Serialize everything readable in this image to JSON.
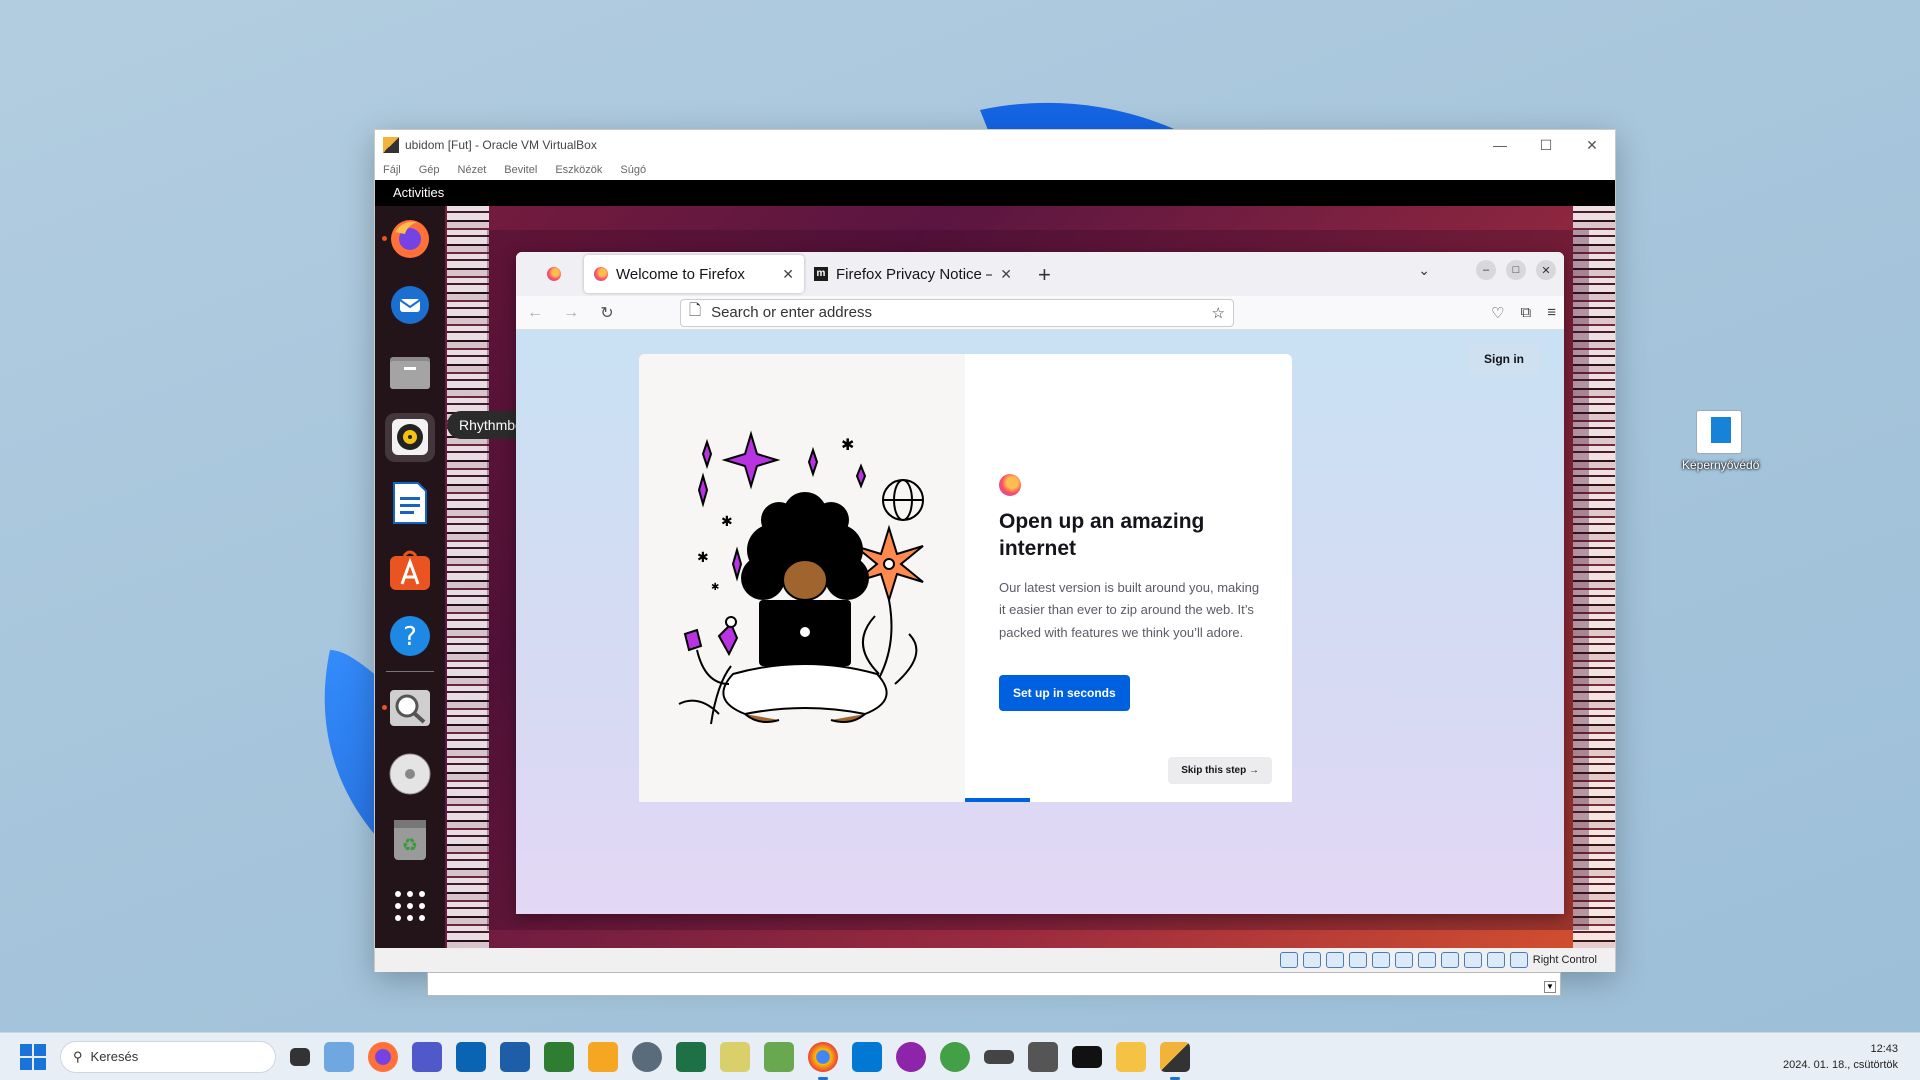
{
  "desktop": {
    "shortcut_label": "Képernyővédő"
  },
  "vbox": {
    "title": "ubidom [Fut] - Oracle VM VirtualBox",
    "menu": [
      "Fájl",
      "Gép",
      "Nézet",
      "Bevitel",
      "Eszközök",
      "Súgó"
    ],
    "host_key_label": "Right Control"
  },
  "ubuntu": {
    "topbar_text": "Activities",
    "tooltip": "Rhythmbox",
    "dock_items": [
      "firefox",
      "thunderbird",
      "files",
      "rhythmbox",
      "libreoffice-writer",
      "app-center",
      "help",
      "image-viewer",
      "disc",
      "trash",
      "show-apps"
    ]
  },
  "firefox": {
    "tabs": [
      {
        "label": "Welcome to Firefox",
        "icon": "firefox-icon"
      },
      {
        "label": "Firefox Privacy Notice —",
        "icon": "mdn-icon"
      }
    ],
    "url_placeholder": "Search or enter address",
    "signin_label": "Sign in",
    "headline": "Open up an amazing internet",
    "subtext": "Our latest version is built around you, making it easier than ever to zip around the web. It’s packed with features we think you’ll adore.",
    "primary_button": "Set up in seconds",
    "skip_button": "Skip this step →",
    "progress_fraction": 0.2
  },
  "taskbar": {
    "search_placeholder": "Keresés",
    "time": "12:43",
    "date": "2024. 01. 18., csütörtök"
  },
  "colors": {
    "accent": "#0061e0",
    "ubuntu_orange": "#e95420",
    "windows_blue": "#1a73d9"
  }
}
